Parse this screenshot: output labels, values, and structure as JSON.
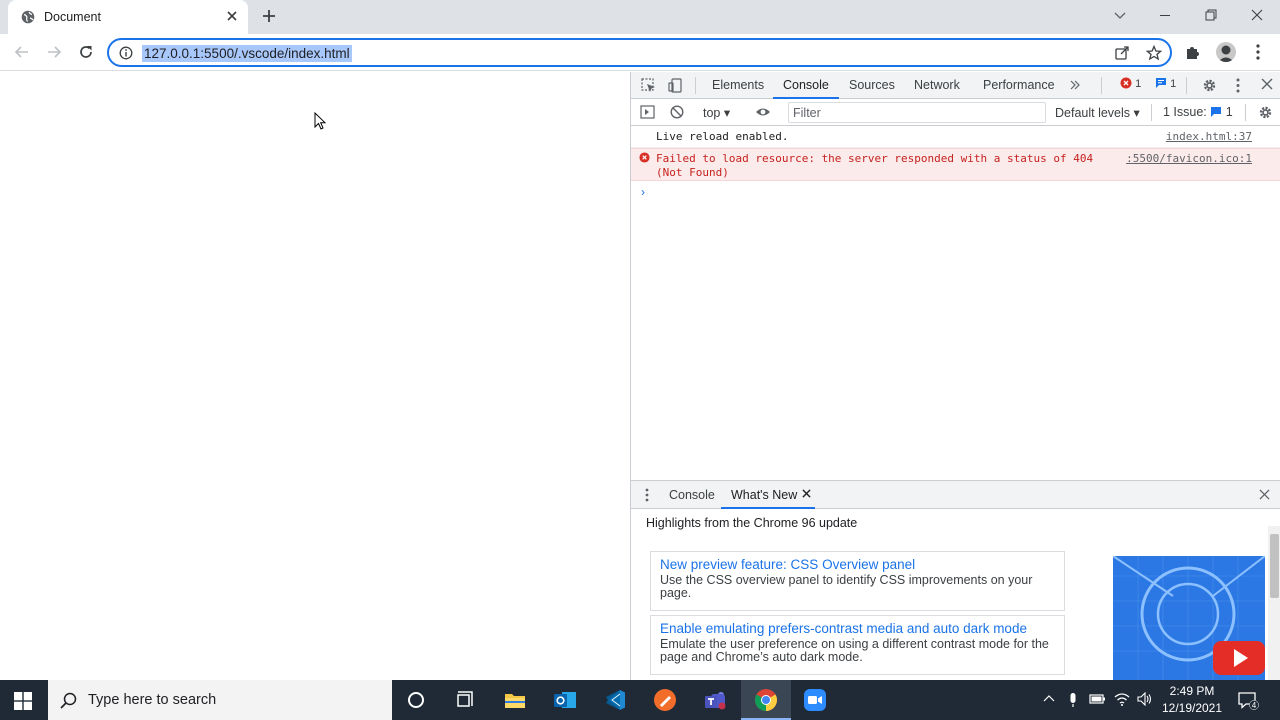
{
  "browser": {
    "tab_title": "Document",
    "url": "127.0.0.1:5500/.vscode/index.html"
  },
  "devtools": {
    "tabs": [
      "Elements",
      "Console",
      "Sources",
      "Network",
      "Performance"
    ],
    "active_tab": "Console",
    "error_count": "1",
    "message_count": "1",
    "context": "top",
    "filter_placeholder": "Filter",
    "levels": "Default levels",
    "issues_label": "1 Issue:",
    "issues_count": "1",
    "messages": [
      {
        "type": "log",
        "text": "Live reload enabled.",
        "source": "index.html:37"
      },
      {
        "type": "error",
        "text": "Failed to load resource: the server responded with a status of 404 (Not Found)",
        "source": ":5500/favicon.ico:1"
      }
    ],
    "drawer": {
      "tabs": [
        "Console",
        "What's New"
      ],
      "active_tab": "What's New",
      "header": "Highlights from the Chrome 96 update",
      "cards": [
        {
          "title": "New preview feature: CSS Overview panel",
          "desc": "Use the CSS overview panel to identify CSS improvements on your page."
        },
        {
          "title": "Enable emulating prefers-contrast media and auto dark mode",
          "desc": "Emulate the user preference on using a different contrast mode for the page and Chrome’s auto dark mode."
        }
      ]
    }
  },
  "taskbar": {
    "search_placeholder": "Type here to search",
    "time": "2:49 PM",
    "date": "12/19/2021",
    "notification_count": "4"
  },
  "colors": {
    "accent": "#1a73e8",
    "error": "#c5221f",
    "taskbar": "#1f2a36"
  }
}
